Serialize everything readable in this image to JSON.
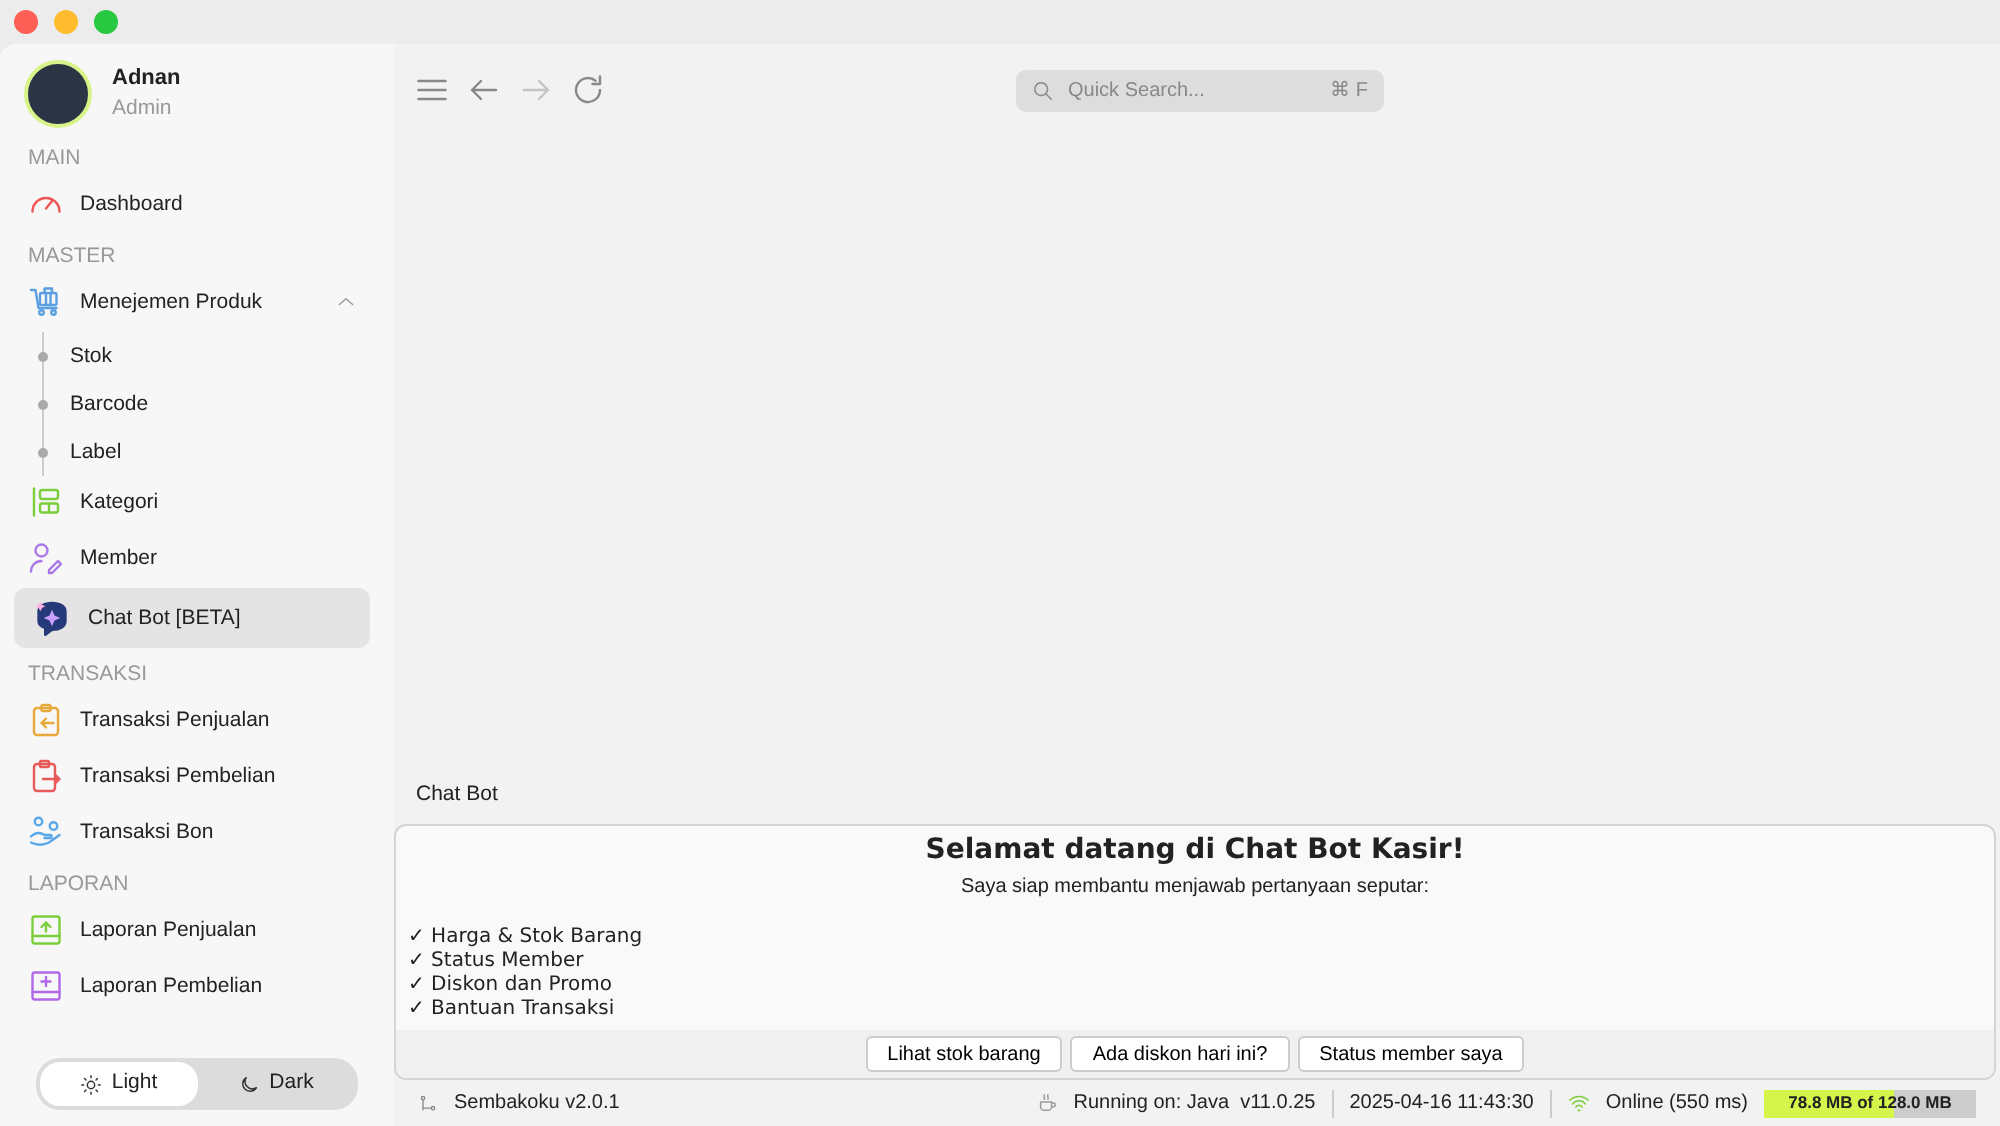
{
  "user": {
    "name": "Adnan",
    "role": "Admin"
  },
  "sidebar": {
    "sections": [
      {
        "title": "MAIN",
        "items": [
          {
            "label": "Dashboard",
            "kind": "dashboard",
            "selected": false
          }
        ]
      },
      {
        "title": "MASTER",
        "items": [
          {
            "label": "Menejemen Produk",
            "kind": "cart",
            "selected": false,
            "expanded": true,
            "children": [
              {
                "label": "Stok"
              },
              {
                "label": "Barcode"
              },
              {
                "label": "Label"
              }
            ]
          },
          {
            "label": "Kategori",
            "kind": "category",
            "selected": false
          },
          {
            "label": "Member",
            "kind": "member",
            "selected": false
          },
          {
            "label": "Chat Bot [BETA]",
            "kind": "bot",
            "selected": true
          }
        ]
      },
      {
        "title": "TRANSAKSI",
        "items": [
          {
            "label": "Transaksi Penjualan",
            "kind": "sale",
            "selected": false
          },
          {
            "label": "Transaksi Pembelian",
            "kind": "purchase",
            "selected": false
          },
          {
            "label": "Transaksi Bon",
            "kind": "debt",
            "selected": false
          }
        ]
      },
      {
        "title": "LAPORAN",
        "items": [
          {
            "label": "Laporan Penjualan",
            "kind": "report_sale",
            "selected": false
          },
          {
            "label": "Laporan Pembelian",
            "kind": "report_purchase",
            "selected": false
          }
        ]
      }
    ]
  },
  "theme_toggle": [
    {
      "label": "Light",
      "kind": "light",
      "selected": true
    },
    {
      "label": "Dark",
      "kind": "dark",
      "selected": false
    }
  ],
  "toolbar": {
    "forward_disabled": true,
    "search": {
      "placeholder": "Quick Search...",
      "shortcut": "⌘ F"
    }
  },
  "chat": {
    "title": "Chat Bot",
    "heading": "Selamat datang di Chat Bot Kasir!",
    "intro": "Saya siap membantu menjawab pertanyaan seputar:",
    "topics": [
      "✓ Harga & Stok Barang",
      "✓ Status Member",
      "✓ Diskon dan Promo",
      "✓ Bantuan Transaksi"
    ],
    "suggestions": [
      "Lihat stok barang",
      "Ada diskon hari ini?",
      "Status member saya"
    ]
  },
  "status_bar": {
    "app": "Sembakoku v2.0.1",
    "runtime": "Running on: Java  v11.0.25",
    "datetime": "2025-04-16 11:43:30",
    "network": "Online (550 ms)",
    "memory": {
      "reading": "78.8 MB of 128.0 MB",
      "level": 0.616
    }
  }
}
